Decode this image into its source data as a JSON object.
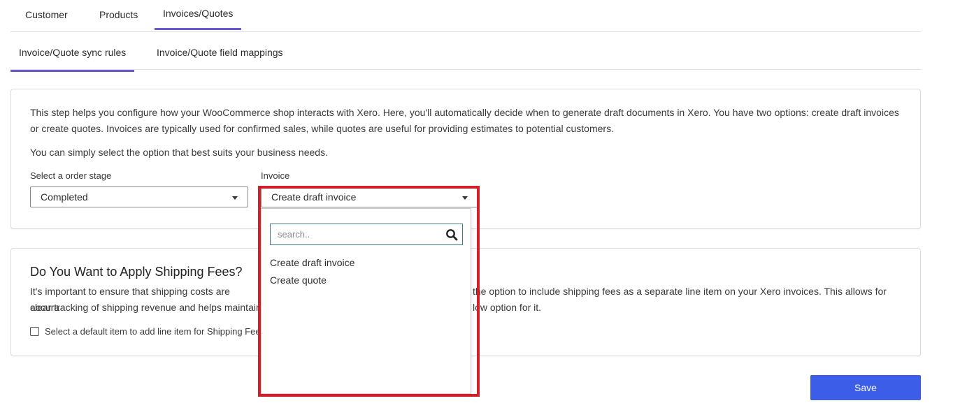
{
  "main_tabs": [
    "Customer",
    "Products",
    "Invoices/Quotes"
  ],
  "sub_tabs": [
    "Invoice/Quote sync rules",
    "Invoice/Quote field mappings"
  ],
  "sync_card": {
    "line1": "This step helps you configure how your WooCommerce shop interacts with Xero. Here, you'll automatically decide when to generate draft documents in Xero. You have two options: create draft invoices",
    "line2": "or create quotes. Invoices are typically used for confirmed sales, while quotes are useful for providing estimates to potential customers.",
    "line3": "You can simply select the option that best suits your business needs.",
    "order_stage_label": "Select a order stage",
    "order_stage_value": "Completed",
    "invoice_label": "Invoice",
    "invoice_value": "Create draft invoice"
  },
  "dropdown": {
    "search_placeholder": "search..",
    "options": [
      "Create draft invoice",
      "Create quote"
    ]
  },
  "shipping_card": {
    "title": "Do You Want to Apply Shipping Fees?",
    "line1_left": "It's important to ensure that shipping costs are accura",
    "line1_right": "the option to include shipping fees as a separate line item on your Xero invoices. This allows for",
    "line2_left": "clear tracking of shipping revenue and helps maintair",
    "line2_right": "low option for it.",
    "checkbox_label": "Select a default item to add line item for Shipping Fee"
  },
  "save_label": "Save",
  "colors": {
    "accent": "#6a5acd",
    "save_button": "#3b5de7",
    "highlight": "#d0202a"
  }
}
